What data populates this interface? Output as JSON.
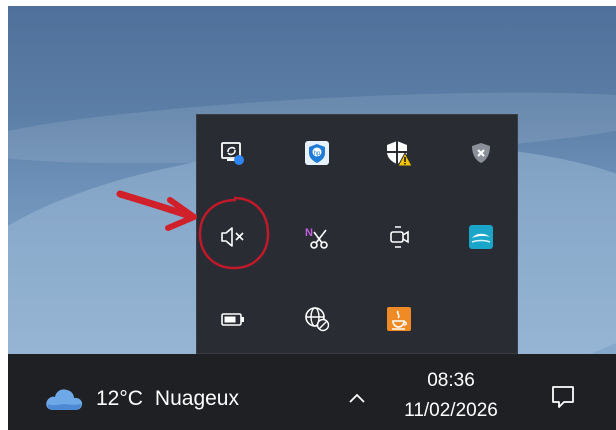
{
  "taskbar": {
    "weather": {
      "icon": "cloud-icon",
      "temperature": "12°C",
      "condition": "Nuageux"
    },
    "clock": {
      "time": "08:36",
      "date": "11/02/2026"
    },
    "show_hidden_icon": "chevron-up-icon",
    "notifications_icon": "notification-bubble-icon"
  },
  "tray_popup": {
    "icons": [
      {
        "name": "display-sync-icon"
      },
      {
        "name": "hp-security-shield-icon"
      },
      {
        "name": "windows-security-warning-icon"
      },
      {
        "name": "vpn-shield-disconnected-icon"
      },
      {
        "name": "speaker-muted-icon"
      },
      {
        "name": "onenote-clipping-icon"
      },
      {
        "name": "camera-icon"
      },
      {
        "name": "cloud-sync-app-icon"
      },
      {
        "name": "battery-icon"
      },
      {
        "name": "network-globe-disconnected-icon"
      },
      {
        "name": "java-update-icon"
      }
    ]
  },
  "annotations": {
    "arrow_color": "#d0202a",
    "circle_color": "#c0192a"
  },
  "colors": {
    "taskbar_bg": "#1f2023",
    "popup_bg": "#292c33",
    "warning_yellow": "#f5c400",
    "java_orange": "#f08a24",
    "teal_app": "#1aa6c8"
  }
}
